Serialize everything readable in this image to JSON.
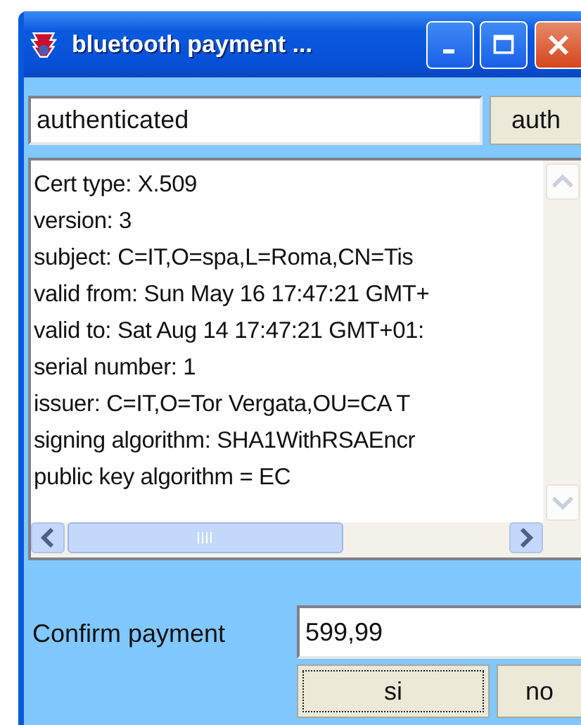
{
  "window": {
    "title": "bluetooth payment ..."
  },
  "auth_field": {
    "value": "authenticated"
  },
  "auth_button": "auth",
  "certificate_lines": [
    "Cert type: X.509",
    "version: 3",
    "subject: C=IT,O=spa,L=Roma,CN=Tis",
    "valid from: Sun May 16 17:47:21 GMT+",
    "valid to: Sat Aug 14 17:47:21 GMT+01:",
    "serial number: 1",
    "issuer: C=IT,O=Tor Vergata,OU=CA T",
    "signing algorithm: SHA1WithRSAEncr",
    "public key algorithm = EC"
  ],
  "confirm": {
    "label": "Confirm payment",
    "value": "599,99"
  },
  "buttons": [
    {
      "label": "si",
      "focused": true
    },
    {
      "label": "no",
      "focused": false
    }
  ]
}
